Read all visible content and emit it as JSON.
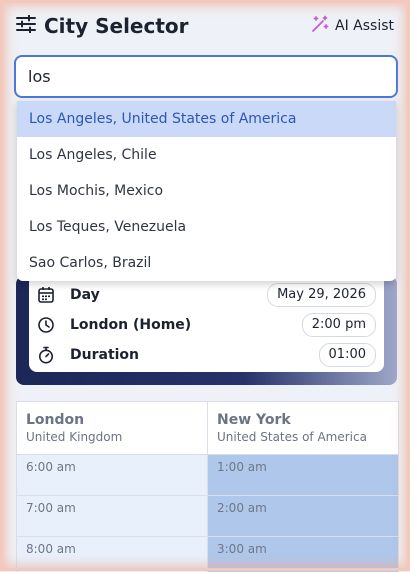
{
  "header": {
    "title": "City Selector",
    "ai_assist_label": "AI Assist",
    "accent_color": "#c75bd6"
  },
  "search": {
    "value": "los"
  },
  "suggestions": [
    "Los Angeles, United States of America",
    "Los Angeles, Chile",
    "Los Mochis, Mexico",
    "Los Teques, Venezuela",
    "Sao Carlos, Brazil"
  ],
  "details": {
    "day_label": "Day",
    "day_value": "May 29, 2026",
    "home_label": "London (Home)",
    "home_value": "2:00 pm",
    "duration_label": "Duration",
    "duration_value": "01:00"
  },
  "timezones": [
    {
      "city": "London",
      "country": "United Kingdom",
      "times": [
        "6:00 am",
        "7:00 am",
        "8:00 am"
      ]
    },
    {
      "city": "New York",
      "country": "United States of America",
      "times": [
        "1:00 am",
        "2:00 am",
        "3:00 am"
      ]
    }
  ]
}
